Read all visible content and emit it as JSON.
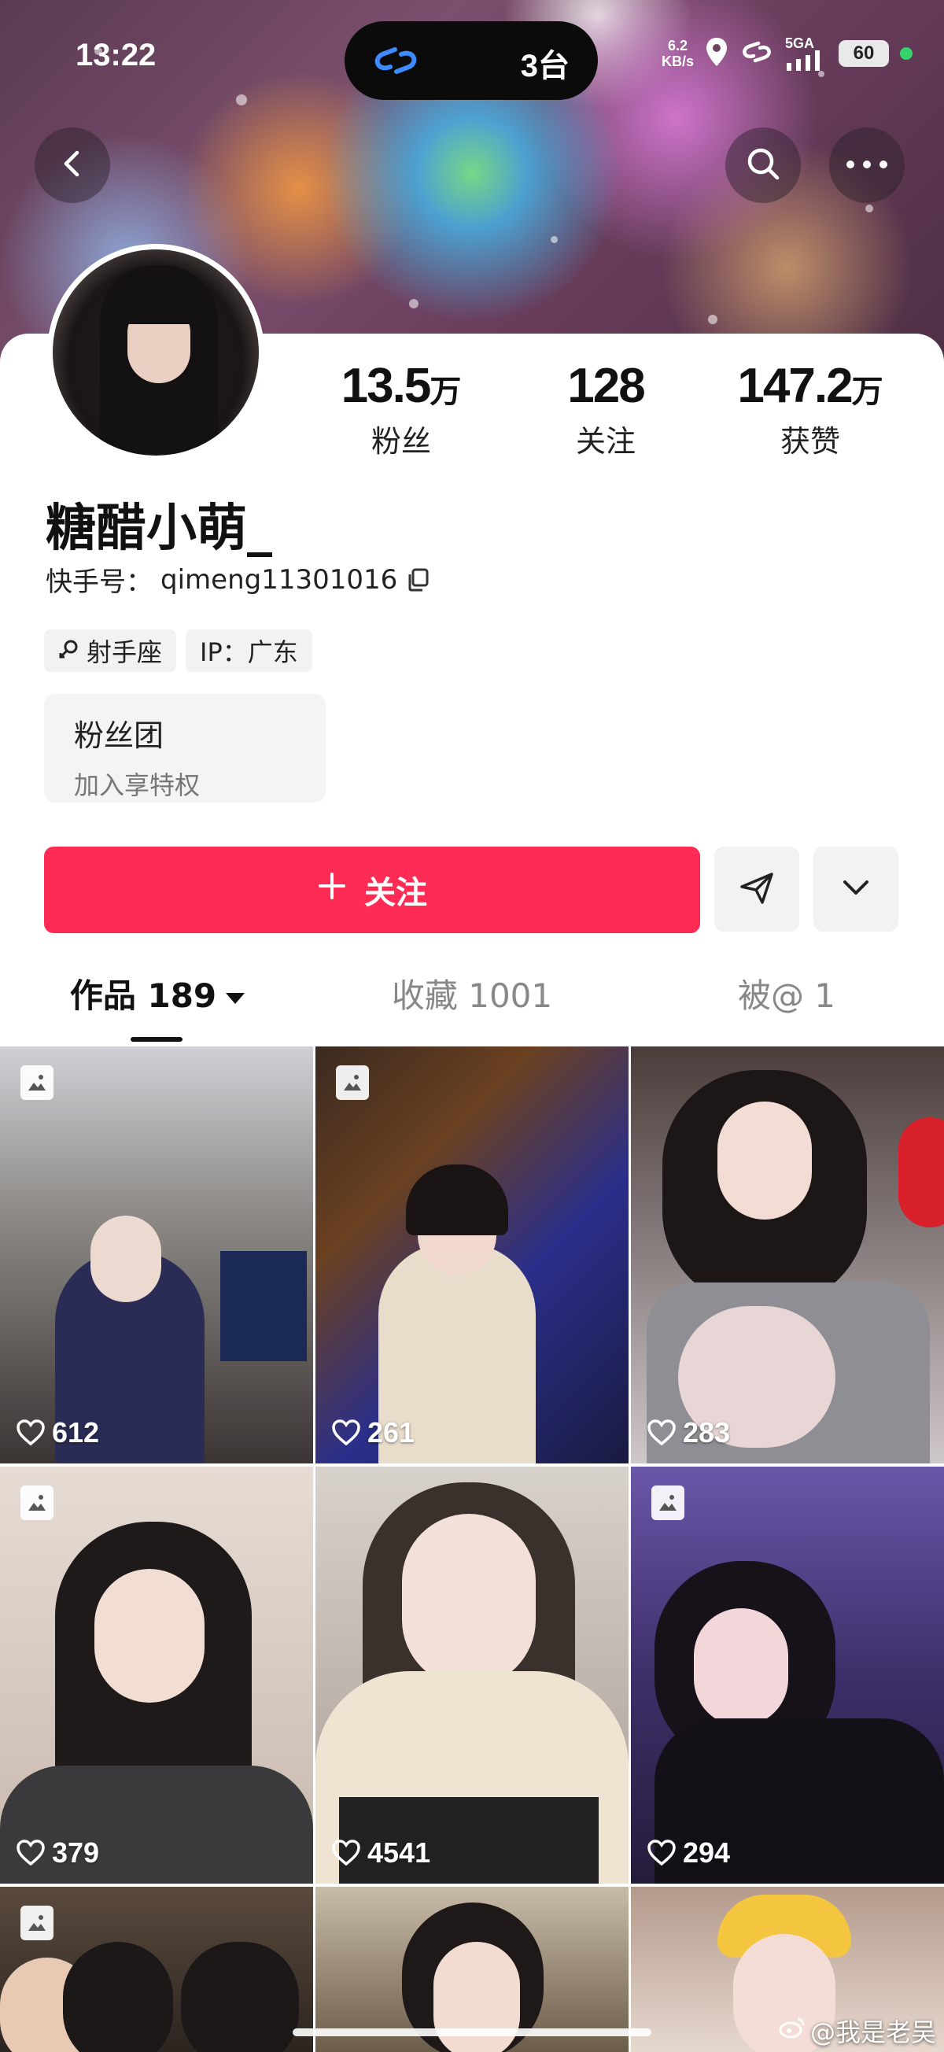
{
  "status_bar": {
    "time": "13:22",
    "island_count": "3台",
    "net_speed_top": "6.2",
    "net_speed_unit": "KB/s",
    "signal_label": "5GA",
    "battery": "60"
  },
  "profile": {
    "nickname": "糖醋小萌_",
    "uid_label": "快手号：",
    "uid_value": "qimeng11301016",
    "stats": [
      {
        "num": "13.5",
        "unit": "万",
        "label": "粉丝"
      },
      {
        "num": "128",
        "unit": "",
        "label": "关注"
      },
      {
        "num": "147.2",
        "unit": "万",
        "label": "获赞"
      }
    ],
    "tags": [
      {
        "icon": "male-symbol-icon",
        "text": "射手座"
      },
      {
        "icon": "",
        "text": "IP：广东"
      }
    ],
    "fan_group": {
      "title": "粉丝团",
      "subtitle": "加入享特权"
    }
  },
  "actions": {
    "follow_label": "关注",
    "follow_color": "#fe2c55"
  },
  "tabs": [
    {
      "label": "作品 189",
      "active": true
    },
    {
      "label": "收藏 1001",
      "active": false
    },
    {
      "label": "被@ 1",
      "active": false
    }
  ],
  "posts": [
    {
      "likes": "612",
      "image_badge": true
    },
    {
      "likes": "261",
      "image_badge": true
    },
    {
      "likes": "283",
      "image_badge": false
    },
    {
      "likes": "379",
      "image_badge": true
    },
    {
      "likes": "4541",
      "image_badge": false
    },
    {
      "likes": "294",
      "image_badge": true
    },
    {
      "likes": "",
      "image_badge": true
    },
    {
      "likes": "",
      "image_badge": false
    },
    {
      "likes": "",
      "image_badge": false
    }
  ],
  "watermark": "@我是老吴"
}
